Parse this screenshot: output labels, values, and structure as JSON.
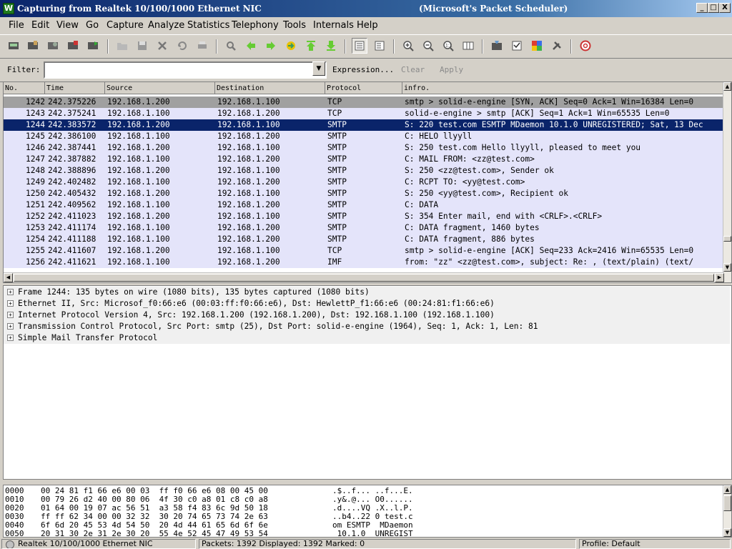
{
  "window": {
    "title": "Capturing from Realtek 10/100/1000 Ethernet NIC",
    "subtitle": "(Microsoft's Packet Scheduler)",
    "controls": [
      "_",
      "□",
      "X"
    ]
  },
  "menu": [
    "File",
    "Edit",
    "View",
    "Go",
    "Capture",
    "Analyze",
    "Statistics",
    "Telephony",
    "Tools",
    "Internals",
    "Help"
  ],
  "toolbar": {
    "icons": [
      "interfaces-icon",
      "options-icon",
      "start-capture-icon",
      "stop-capture-icon",
      "restart-capture-icon",
      "open-icon",
      "save-icon",
      "close-icon",
      "reload-icon",
      "print-icon",
      "find-icon",
      "back-icon",
      "forward-icon",
      "go-to-packet-icon",
      "first-packet-icon",
      "last-packet-icon",
      "colorize-icon",
      "autoscroll-icon",
      "zoom-in-icon",
      "zoom-out-icon",
      "normal-size-icon",
      "resize-columns-icon",
      "capture-filters-icon",
      "display-filters-icon",
      "coloring-rules-icon",
      "preferences-icon",
      "help-icon"
    ]
  },
  "filter": {
    "label": "Filter:",
    "value": "",
    "expression_label": "Expression...",
    "clear_label": "Clear",
    "apply_label": "Apply"
  },
  "packet_list": {
    "columns": [
      "No.",
      "Time",
      "Source",
      "Destination",
      "Protocol",
      "infro."
    ],
    "rows": [
      {
        "no": "1242",
        "time": "242.375226",
        "src": "192.168.1.200",
        "dst": "192.168.1.100",
        "proto": "TCP",
        "info": "smtp > solid-e-engine [SYN, ACK] Seq=0 Ack=1 Win=16384 Len=0",
        "style": "gray"
      },
      {
        "no": "1243",
        "time": "242.375241",
        "src": "192.168.1.100",
        "dst": "192.168.1.200",
        "proto": "TCP",
        "info": "solid-e-engine > smtp [ACK] Seq=1 Ack=1 Win=65535 Len=0",
        "style": "tcp"
      },
      {
        "no": "1244",
        "time": "242.383572",
        "src": "192.168.1.200",
        "dst": "192.168.1.100",
        "proto": "SMTP",
        "info": "S: 220 test.com ESMTP MDaemon 10.1.0 UNREGISTERED; Sat, 13 Dec",
        "style": "selected"
      },
      {
        "no": "1245",
        "time": "242.386100",
        "src": "192.168.1.100",
        "dst": "192.168.1.200",
        "proto": "SMTP",
        "info": "C: HELO llyyll",
        "style": "tcp"
      },
      {
        "no": "1246",
        "time": "242.387441",
        "src": "192.168.1.200",
        "dst": "192.168.1.100",
        "proto": "SMTP",
        "info": "S: 250 test.com Hello llyyll, pleased to meet you",
        "style": "tcp"
      },
      {
        "no": "1247",
        "time": "242.387882",
        "src": "192.168.1.100",
        "dst": "192.168.1.200",
        "proto": "SMTP",
        "info": "C: MAIL FROM: <zz@test.com>",
        "style": "tcp"
      },
      {
        "no": "1248",
        "time": "242.388896",
        "src": "192.168.1.200",
        "dst": "192.168.1.100",
        "proto": "SMTP",
        "info": "S: 250 <zz@test.com>, Sender ok",
        "style": "tcp"
      },
      {
        "no": "1249",
        "time": "242.402482",
        "src": "192.168.1.100",
        "dst": "192.168.1.200",
        "proto": "SMTP",
        "info": "C: RCPT TO: <yy@test.com>",
        "style": "tcp"
      },
      {
        "no": "1250",
        "time": "242.405432",
        "src": "192.168.1.200",
        "dst": "192.168.1.100",
        "proto": "SMTP",
        "info": "S: 250 <yy@test.com>, Recipient ok",
        "style": "tcp"
      },
      {
        "no": "1251",
        "time": "242.409562",
        "src": "192.168.1.100",
        "dst": "192.168.1.200",
        "proto": "SMTP",
        "info": "C: DATA",
        "style": "tcp"
      },
      {
        "no": "1252",
        "time": "242.411023",
        "src": "192.168.1.200",
        "dst": "192.168.1.100",
        "proto": "SMTP",
        "info": "S: 354 Enter mail, end with <CRLF>.<CRLF>",
        "style": "tcp"
      },
      {
        "no": "1253",
        "time": "242.411174",
        "src": "192.168.1.100",
        "dst": "192.168.1.200",
        "proto": "SMTP",
        "info": "C: DATA fragment, 1460 bytes",
        "style": "tcp"
      },
      {
        "no": "1254",
        "time": "242.411188",
        "src": "192.168.1.100",
        "dst": "192.168.1.200",
        "proto": "SMTP",
        "info": "C: DATA fragment, 886 bytes",
        "style": "tcp"
      },
      {
        "no": "1255",
        "time": "242.411607",
        "src": "192.168.1.200",
        "dst": "192.168.1.100",
        "proto": "TCP",
        "info": "smtp > solid-e-engine [ACK] Seq=233 Ack=2416 Win=65535 Len=0",
        "style": "tcp"
      },
      {
        "no": "1256",
        "time": "242.411621",
        "src": "192.168.1.100",
        "dst": "192.168.1.200",
        "proto": "IMF",
        "info": "from: \"zz\" <zz@test.com>, subject: Re: ,  (text/plain) (text/",
        "style": "tcp"
      }
    ]
  },
  "details": [
    "Frame 1244: 135 bytes on wire (1080 bits), 135 bytes captured (1080 bits)",
    "Ethernet II, Src: Microsof_f0:66:e6 (00:03:ff:f0:66:e6), Dst: HewlettP_f1:66:e6 (00:24:81:f1:66:e6)",
    "Internet Protocol Version 4, Src: 192.168.1.200 (192.168.1.200), Dst: 192.168.1.100 (192.168.1.100)",
    "Transmission Control Protocol, Src Port: smtp (25), Dst Port: solid-e-engine (1964), Seq: 1, Ack: 1, Len: 81",
    "Simple Mail Transfer Protocol"
  ],
  "hex": [
    {
      "offset": "0000",
      "bytes": "00 24 81 f1 66 e6 00 03  ff f0 66 e6 08 00 45 00",
      "ascii": ".$..f... ..f...E."
    },
    {
      "offset": "0010",
      "bytes": "00 79 26 d2 40 00 80 06  4f 30 c0 a8 01 c8 c0 a8",
      "ascii": ".y&.@... O0......"
    },
    {
      "offset": "0020",
      "bytes": "01 64 00 19 07 ac 56 51  a3 58 f4 83 6c 9d 50 18",
      "ascii": ".d....VQ .X..l.P."
    },
    {
      "offset": "0030",
      "bytes": "ff ff 62 34 00 00 32 32  30 20 74 65 73 74 2e 63",
      "ascii": "..b4..22 0 test.c"
    },
    {
      "offset": "0040",
      "bytes": "6f 6d 20 45 53 4d 54 50  20 4d 44 61 65 6d 6f 6e",
      "ascii": "om ESMTP  MDaemon"
    },
    {
      "offset": "0050",
      "bytes": "20 31 30 2e 31 2e 30 20  55 4e 52 45 47 49 53 54",
      "ascii": " 10.1.0  UNREGIST"
    }
  ],
  "status": {
    "interface": "Realtek 10/100/1000 Ethernet NIC",
    "packets": "Packets: 1392 Displayed: 1392 Marked: 0",
    "profile": "Profile: Default"
  },
  "colors": {
    "row_tcp": "#e4e4fa",
    "row_gray": "#a0a0a0",
    "row_selected": "#0a246a",
    "details_selected": "#f0f0f0"
  }
}
